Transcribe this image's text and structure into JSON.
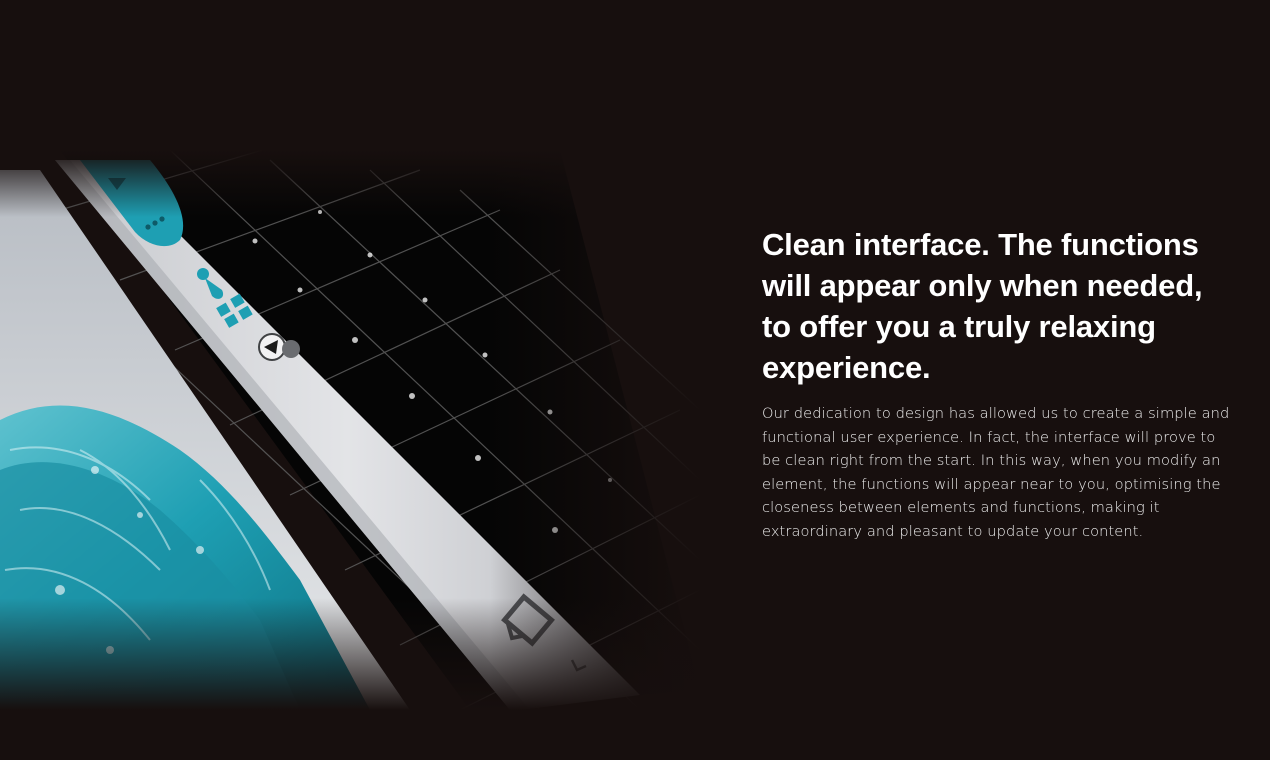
{
  "section": {
    "headline": "Clean interface. The functions will appear only when needed, to offer you a truly relaxing experience.",
    "body": "Our dedication to design has allowed us to create a simple and functional user experience. In fact, the interface will prove to be clean right from the start. In this way, when you modify an element, the functions will appear near to you, optimising the closeness between elements and functions, making it extraordinary and pleasant to update your content."
  },
  "visual": {
    "icons": [
      "menu-dots-icon",
      "paint-bucket-icon",
      "grid-squares-icon",
      "play-icon",
      "monitor-icon",
      "chevron-icon"
    ]
  },
  "colors": {
    "background": "#170f0e",
    "accent": "#1e9fb3",
    "toolbar": "#d9dadd",
    "text": "#ffffff"
  }
}
